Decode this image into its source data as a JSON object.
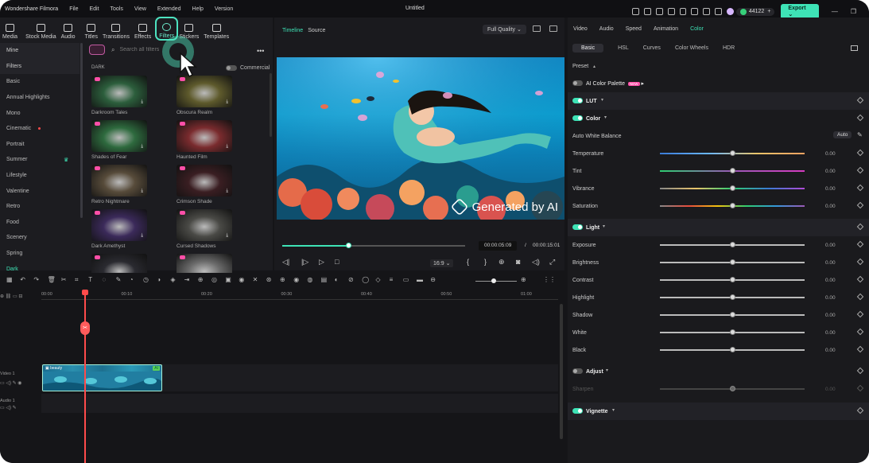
{
  "app": {
    "name": "Wondershare Filmora",
    "document_title": "Untitled"
  },
  "menu": [
    "File",
    "Edit",
    "Tools",
    "View",
    "Extended",
    "Help",
    "Version"
  ],
  "topbar": {
    "credits": "44122",
    "credits_plus": "+",
    "export_label": "Export"
  },
  "media_tabs": [
    {
      "label": "Media",
      "active": false
    },
    {
      "label": "Stock Media",
      "active": false
    },
    {
      "label": "Audio",
      "active": false
    },
    {
      "label": "Titles",
      "active": false
    },
    {
      "label": "Transitions",
      "active": false
    },
    {
      "label": "Effects",
      "active": false
    },
    {
      "label": "Filters",
      "active": true
    },
    {
      "label": "Stickers",
      "active": false
    },
    {
      "label": "Templates",
      "active": false
    }
  ],
  "sidebar": {
    "items": [
      {
        "label": "Mine",
        "kind": "hdr"
      },
      {
        "label": "Filters",
        "kind": "hdr"
      },
      {
        "label": "Basic"
      },
      {
        "label": "Annual Highlights"
      },
      {
        "label": "Mono"
      },
      {
        "label": "Cinematic",
        "new_dot": true
      },
      {
        "label": "Portrait"
      },
      {
        "label": "Summer",
        "crown": true
      },
      {
        "label": "Lifestyle"
      },
      {
        "label": "Valentine"
      },
      {
        "label": "Retro"
      },
      {
        "label": "Food"
      },
      {
        "label": "Scenery"
      },
      {
        "label": "Spring"
      },
      {
        "label": "Dark",
        "selected": true
      }
    ]
  },
  "filters_panel": {
    "search_placeholder": "Search all filters",
    "commercial_label": "Commercial",
    "section_label": "DARK",
    "cards": [
      {
        "label": "Darkroom Tales",
        "color": "#2c5e3c"
      },
      {
        "label": "Obscura Realm",
        "color": "#5e5a2c"
      },
      {
        "label": "Shades of Fear",
        "color": "#2e6a3e"
      },
      {
        "label": "Haunted Film",
        "color": "#7a2b2e"
      },
      {
        "label": "Retro Nightmare",
        "color": "#574b3a"
      },
      {
        "label": "Crimson Shade",
        "color": "#3a1e22"
      },
      {
        "label": "Dark Amethyst",
        "color": "#3b2a5a"
      },
      {
        "label": "Cursed Shadows",
        "color": "#4a4a46"
      },
      {
        "label": "",
        "color": "#2a2a30"
      },
      {
        "label": "",
        "color": "#6a6a6a"
      }
    ]
  },
  "preview": {
    "tab_timeline": "Timeline",
    "tab_source": "Source",
    "quality": "Full Quality",
    "watermark": "Generated by AI",
    "current_time": "00:00:05:09",
    "separator": "/",
    "total_time": "00:00:15:01",
    "progress": 0.36,
    "ratio": "16:9"
  },
  "right_panel": {
    "tabs": [
      {
        "label": "Video",
        "active": false
      },
      {
        "label": "Audio",
        "active": false
      },
      {
        "label": "Speed",
        "active": false
      },
      {
        "label": "Animation",
        "active": false
      },
      {
        "label": "Color",
        "active": true
      }
    ],
    "subtabs": [
      {
        "label": "Basic",
        "active": true
      },
      {
        "label": "HSL",
        "active": false
      },
      {
        "label": "Curves",
        "active": false
      },
      {
        "label": "Color Wheels",
        "active": false
      },
      {
        "label": "HDR",
        "active": false
      }
    ],
    "preset_label": "Preset",
    "ai_palette_label": "AI Color Palette",
    "ai_new": "NEW",
    "lut_label": "LUT",
    "color_label": "Color",
    "awb_label": "Auto White Balance",
    "auto_label": "Auto",
    "color_sliders": [
      {
        "label": "Temperature",
        "value": "0.00",
        "gradient": "linear-gradient(90deg,#3a7bd5,#6ab7ff,#e9c46a,#f4a261)"
      },
      {
        "label": "Tint",
        "value": "0.00",
        "gradient": "linear-gradient(90deg,#2ecc71,#9b59b6,#d63cc1)"
      },
      {
        "label": "Vibrance",
        "value": "0.00",
        "gradient": "linear-gradient(90deg,#888,#e9c46a,#2ecc71,#3a7bd5,#b14bd8)"
      },
      {
        "label": "Saturation",
        "value": "0.00",
        "gradient": "linear-gradient(90deg,#888,#e74c3c,#f1c40f,#2ecc71,#3498db,#9b59b6)"
      }
    ],
    "light_label": "Light",
    "light_sliders": [
      {
        "label": "Exposure",
        "value": "0.00"
      },
      {
        "label": "Brightness",
        "value": "0.00"
      },
      {
        "label": "Contrast",
        "value": "0.00"
      },
      {
        "label": "Highlight",
        "value": "0.00"
      },
      {
        "label": "Shadow",
        "value": "0.00"
      },
      {
        "label": "White",
        "value": "0.00"
      },
      {
        "label": "Black",
        "value": "0.00"
      }
    ],
    "adjust_label": "Adjust",
    "sharpen_label": "Sharpen",
    "sharpen_value": "0.00",
    "vignette_label": "Vignette"
  },
  "timeline": {
    "ruler": [
      "00:00",
      "00:10",
      "00:20",
      "00:30",
      "00:40",
      "00:50",
      "01:00"
    ],
    "video_track": "Video 1",
    "audio_track": "Audio 1",
    "clip_label": "beauty",
    "clip_ai": "AI"
  },
  "colors": {
    "accent": "#3ee3b6",
    "playhead": "#ff4b4b",
    "bg": "#151518"
  }
}
